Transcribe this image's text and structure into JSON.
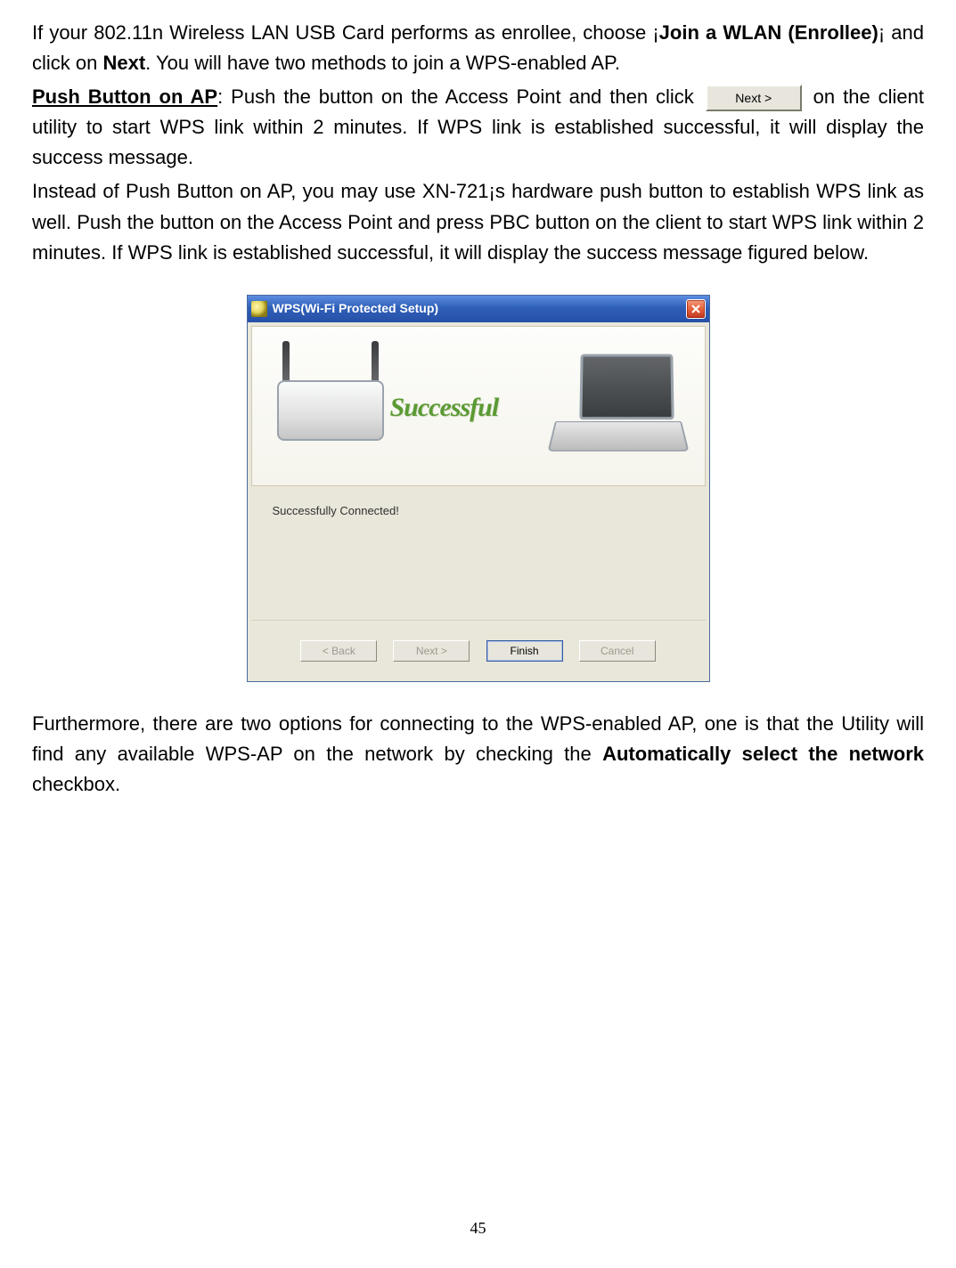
{
  "para1": {
    "pre": "If your 802.11n Wireless LAN USB Card performs as enrollee, choose ¡",
    "bold1": "Join a WLAN (Enrollee)",
    "mid": "¡ and click on ",
    "bold2": "Next",
    "post": ".    You will have two methods to join a WPS-enabled AP."
  },
  "para2": {
    "heading": "Push Button on AP",
    "pre": ": Push the button on the Access Point and then click ",
    "btn_label": "Next >",
    "post1": " on the client utility to start WPS link within 2 minutes.    If WPS link is established successful, it will display the success message.",
    "post2": "Instead of Push Button on AP, you may use XN-721¡s hardware push button to establish WPS link as well.    Push the button on the Access Point and press PBC button on the client to start WPS link within 2 minutes.    If WPS link is established successful, it will display the success message figured below."
  },
  "dialog": {
    "title": "WPS(Wi-Fi Protected Setup)",
    "success_script": "Successful",
    "message": "Successfully Connected!",
    "buttons": {
      "back": "< Back",
      "next": "Next >",
      "finish": "Finish",
      "cancel": "Cancel"
    }
  },
  "para3": {
    "pre": "Furthermore, there are two options for connecting to the WPS-enabled AP, one is that the Utility will find any available WPS-AP on the network by checking the ",
    "bold": "Automatically select the network",
    "post": " checkbox."
  },
  "page_number": "45"
}
